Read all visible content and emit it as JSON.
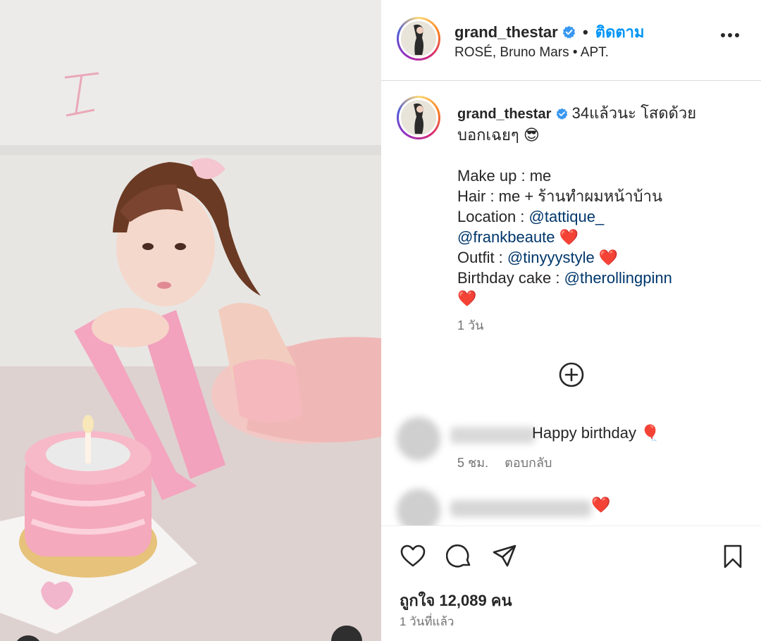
{
  "post": {
    "username": "grand_thestar",
    "follow_label": "ติดตาม",
    "audio": "ROSÉ, Bruno Mars • APT.",
    "more_icon": "more-horizontal-icon",
    "verified_color": "#3897f0"
  },
  "caption": {
    "username": "grand_thestar",
    "line1": "34แล้วนะ โสดด้วย",
    "line2": "บอกเฉยๆ 😎",
    "makeup": "Make up : me",
    "hair": "Hair : me + ร้านทำผมหน้าบ้าน",
    "location_prefix": "Location : ",
    "location_mention1": "@tattique_",
    "location_mention2": "@frankbeaute",
    "location_emoji": "❤️",
    "outfit_prefix": "Outfit : ",
    "outfit_mention": "@tinyyystyle",
    "outfit_emoji": "❤️",
    "cake_prefix": "Birthday cake : ",
    "cake_mention": "@therollingpinn",
    "cake_emoji": "❤️",
    "time": "1 วัน"
  },
  "comments": [
    {
      "text": "Happy birthday 🎈",
      "time": "5 ชม.",
      "reply_label": "ตอบกลับ"
    },
    {
      "text": "❤️"
    }
  ],
  "actions": {
    "like_icon": "heart-icon",
    "comment_icon": "comment-icon",
    "share_icon": "send-icon",
    "save_icon": "bookmark-icon",
    "add_icon": "add-circle-icon"
  },
  "footer": {
    "likes": "ถูกใจ 12,089 คน",
    "time": "1 วันที่แล้ว"
  },
  "colors": {
    "link": "#00376b",
    "follow": "#0095f6",
    "secondary": "#737373",
    "border": "#dbdbdb"
  }
}
